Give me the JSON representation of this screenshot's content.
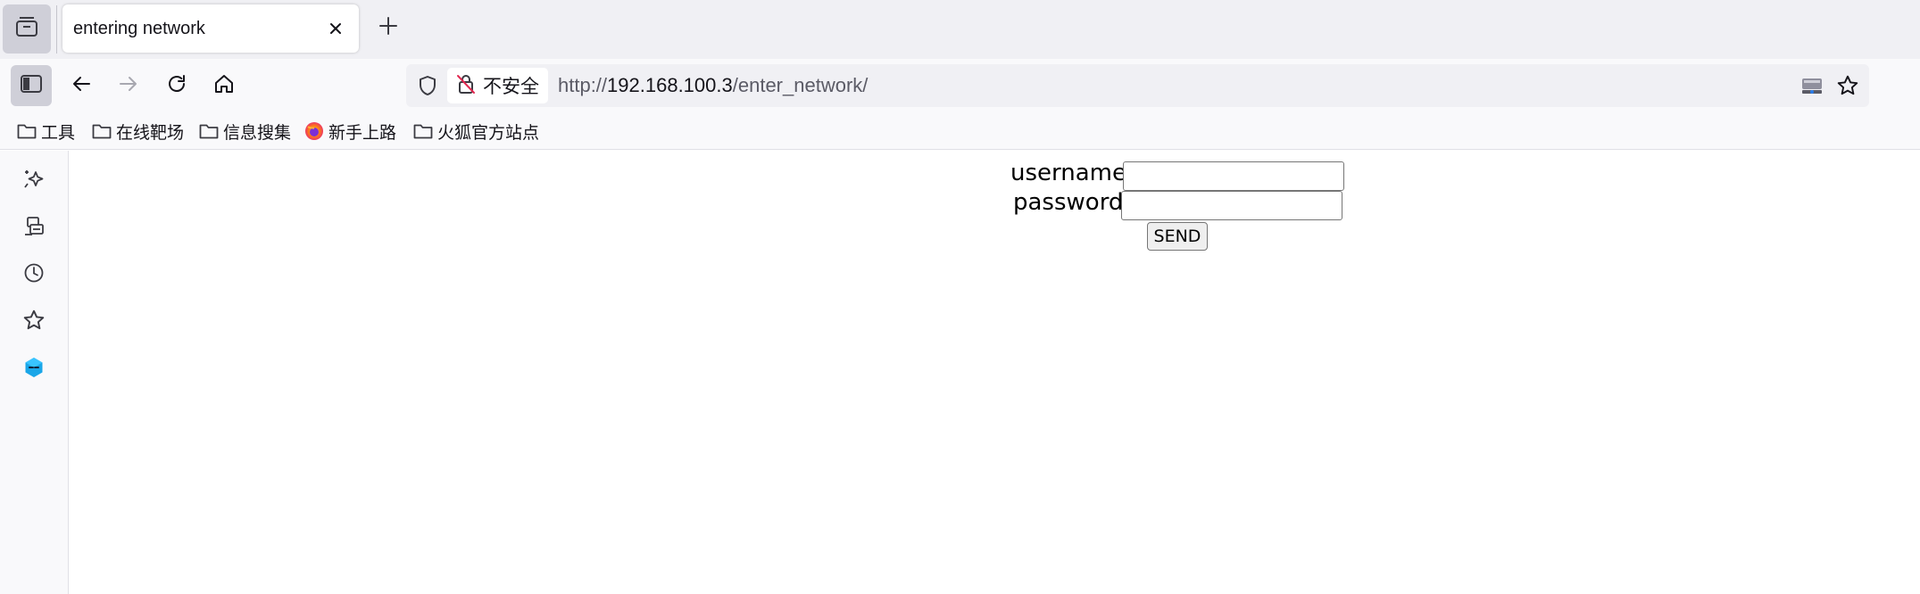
{
  "tab": {
    "title": "entering network"
  },
  "urlbar": {
    "security_label": "不安全",
    "url_protocol": "http://",
    "url_host": "192.168.100.3",
    "url_path": "/enter_network/"
  },
  "bookmarks": [
    {
      "label": "工具",
      "icon": "folder-icon"
    },
    {
      "label": "在线靶场",
      "icon": "folder-icon"
    },
    {
      "label": "信息搜集",
      "icon": "folder-icon"
    },
    {
      "label": "新手上路",
      "icon": "firefox-icon"
    },
    {
      "label": "火狐官方站点",
      "icon": "folder-icon"
    }
  ],
  "sidebar": {
    "icons": [
      "ai-chatbot-icon",
      "synced-tabs-icon",
      "history-icon",
      "bookmarks-icon",
      "extension-icon"
    ]
  },
  "form": {
    "username_label": "username:",
    "password_label": "password:",
    "username_value": "",
    "password_value": "",
    "submit_label": "SEND"
  },
  "colors": {
    "tabstrip_bg": "#f0f0f4",
    "toolbar_bg": "#f9f9fb",
    "urlbar_bg": "#f0f0f4",
    "active_button_bg": "#cfcfd8",
    "extension_accent": "#1aa6e8"
  }
}
